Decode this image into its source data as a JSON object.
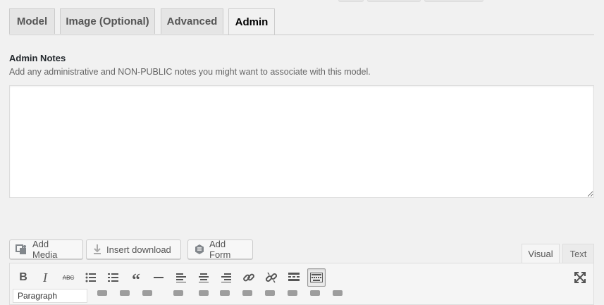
{
  "tabs": [
    {
      "label": "Model",
      "active": false
    },
    {
      "label": "Image (Optional)",
      "active": false
    },
    {
      "label": "Advanced",
      "active": false
    },
    {
      "label": "Admin",
      "active": true
    }
  ],
  "admin_notes": {
    "label": "Admin Notes",
    "description": "Add any administrative and NON-PUBLIC notes you might want to associate with this model.",
    "value": ""
  },
  "media_buttons": {
    "add_media": "Add Media",
    "insert_download": "Insert download",
    "add_form": "Add Form"
  },
  "editor_tabs": {
    "visual": "Visual",
    "text": "Text",
    "active": "visual"
  },
  "toolbar": {
    "buttons": [
      "bold",
      "italic",
      "strikethrough",
      "bulleted-list",
      "numbered-list",
      "blockquote",
      "horizontal-line",
      "align-left",
      "align-center",
      "align-right",
      "insert-link",
      "remove-link",
      "read-more",
      "toolbar-toggle",
      "fullscreen"
    ],
    "toggle_pressed": true,
    "format_select": "Paragraph"
  },
  "colors": {
    "background": "#f1f1f1",
    "active_tab": "#f1f1f1",
    "inactive_tab": "#e5e5e5",
    "border": "#cccccc"
  }
}
